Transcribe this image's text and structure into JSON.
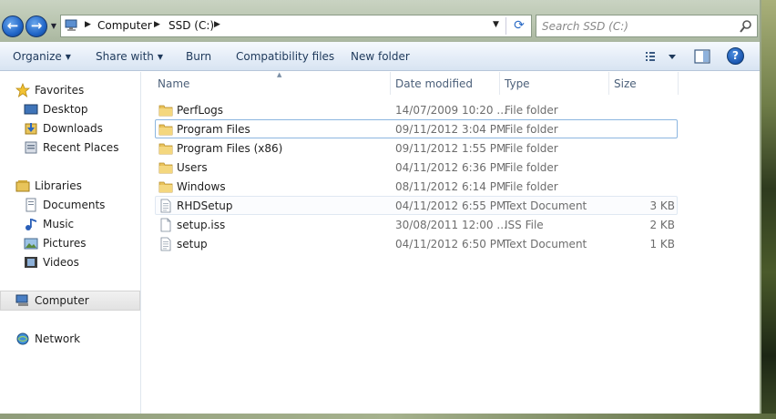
{
  "address": {
    "crumbs": [
      "Computer",
      "SSD (C:)"
    ]
  },
  "search": {
    "placeholder": "Search SSD (C:)"
  },
  "toolbar": {
    "organize": "Organize",
    "share_with": "Share with",
    "burn": "Burn",
    "compatibility": "Compatibility files",
    "new_folder": "New folder"
  },
  "nav": {
    "favorites": "Favorites",
    "desktop": "Desktop",
    "downloads": "Downloads",
    "recent": "Recent Places",
    "libraries": "Libraries",
    "documents": "Documents",
    "music": "Music",
    "pictures": "Pictures",
    "videos": "Videos",
    "computer": "Computer",
    "network": "Network"
  },
  "columns": {
    "name": "Name",
    "date": "Date modified",
    "type": "Type",
    "size": "Size"
  },
  "files": [
    {
      "name": "PerfLogs",
      "date": "14/07/2009 10:20 ...",
      "type": "File folder",
      "size": "",
      "icon": "folder-icon"
    },
    {
      "name": "Program Files",
      "date": "09/11/2012 3:04 PM",
      "type": "File folder",
      "size": "",
      "icon": "folder-icon"
    },
    {
      "name": "Program Files (x86)",
      "date": "09/11/2012 1:55 PM",
      "type": "File folder",
      "size": "",
      "icon": "folder-icon"
    },
    {
      "name": "Users",
      "date": "04/11/2012 6:36 PM",
      "type": "File folder",
      "size": "",
      "icon": "folder-icon"
    },
    {
      "name": "Windows",
      "date": "08/11/2012 6:14 PM",
      "type": "File folder",
      "size": "",
      "icon": "folder-icon"
    },
    {
      "name": "RHDSetup",
      "date": "04/11/2012 6:55 PM",
      "type": "Text Document",
      "size": "3 KB",
      "icon": "text-document-icon"
    },
    {
      "name": "setup.iss",
      "date": "30/08/2011 12:00 ...",
      "type": "ISS File",
      "size": "2 KB",
      "icon": "file-icon"
    },
    {
      "name": "setup",
      "date": "04/11/2012 6:50 PM",
      "type": "Text Document",
      "size": "1 KB",
      "icon": "text-document-icon"
    }
  ]
}
